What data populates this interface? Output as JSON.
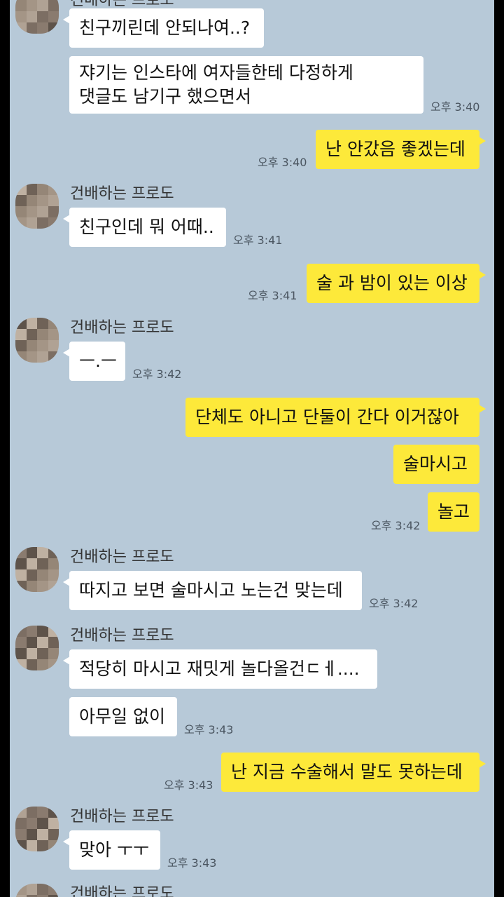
{
  "colors": {
    "background": "#b7c9d8",
    "incoming_bubble": "#ffffff",
    "outgoing_bubble": "#fde93a"
  },
  "sender_name": "건배하는 프로도",
  "messages": [
    {
      "text": "친구끼린데 안되나여..?"
    },
    {
      "lines": [
        "쟈기는 인스타에 여자들한테 다정하게",
        "댓글도 남기구 했으면서"
      ],
      "time": "오후 3:40"
    },
    {
      "text": "난 안갔음 좋겠는데",
      "time": "오후 3:40"
    },
    {
      "text": "친구인데 뭐 어때..",
      "time": "오후 3:41"
    },
    {
      "text": "술 과 밤이 있는 이상",
      "time": "오후 3:41"
    },
    {
      "text": "ㅡ.ㅡ",
      "time": "오후 3:42"
    },
    {
      "text": "단체도 아니고 단둘이 간다 이거잖아"
    },
    {
      "text": "술마시고"
    },
    {
      "text": "놀고",
      "time": "오후 3:42"
    },
    {
      "text": "따지고 보면 술마시고 노는건 맞는데",
      "time": "오후 3:42"
    },
    {
      "text": "적당히 마시고 재밋게 놀다올건ㄷㅔ...."
    },
    {
      "text": "아무일 없이",
      "time": "오후 3:43"
    },
    {
      "text": "난 지금 수술해서 말도 못하는데",
      "time": "오후 3:43"
    },
    {
      "text": "맞아 ㅜㅜ",
      "time": "오후 3:43"
    }
  ]
}
